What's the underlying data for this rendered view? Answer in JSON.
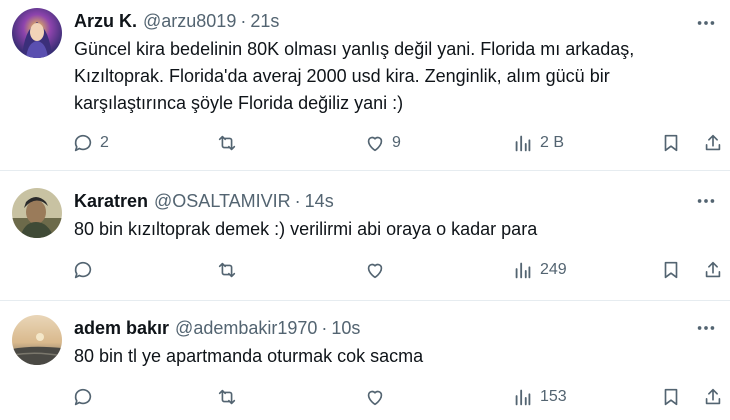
{
  "tweets": [
    {
      "name": "Arzu K.",
      "handle": "@arzu8019",
      "dot": "·",
      "time": "21s",
      "text": "Güncel kira bedelinin 80K olması yanlış değil yani. Florida mı arkadaş, Kızıltoprak. Florida'da averaj 2000 usd kira. Zenginlik, alım gücü bir karşılaştırınca şöyle Florida değiliz yani :)",
      "replies": "2",
      "retweets": "",
      "likes": "9",
      "views": "2 B"
    },
    {
      "name": "Karatren",
      "handle": "@OSALTAMIVIR",
      "dot": "·",
      "time": "14s",
      "text": "80 bin kızıltoprak demek :) verilirmi abi oraya o kadar para",
      "replies": "",
      "retweets": "",
      "likes": "",
      "views": "249"
    },
    {
      "name": "adem bakır",
      "handle": "@adembakir1970",
      "dot": "·",
      "time": "10s",
      "text": "80 bin tl ye apartmanda oturmak cok sacma",
      "replies": "",
      "retweets": "",
      "likes": "",
      "views": "153"
    }
  ],
  "icons": {
    "more": "more-horizontal-icon",
    "reply": "reply-bubble-icon",
    "retweet": "retweet-arrows-icon",
    "like": "heart-icon",
    "views": "bar-chart-icon",
    "bookmark": "bookmark-icon",
    "share": "share-upload-icon"
  },
  "colors": {
    "text": "#0f1419",
    "secondary": "#536471",
    "divider": "#e6ecf0",
    "background": "#ffffff"
  }
}
